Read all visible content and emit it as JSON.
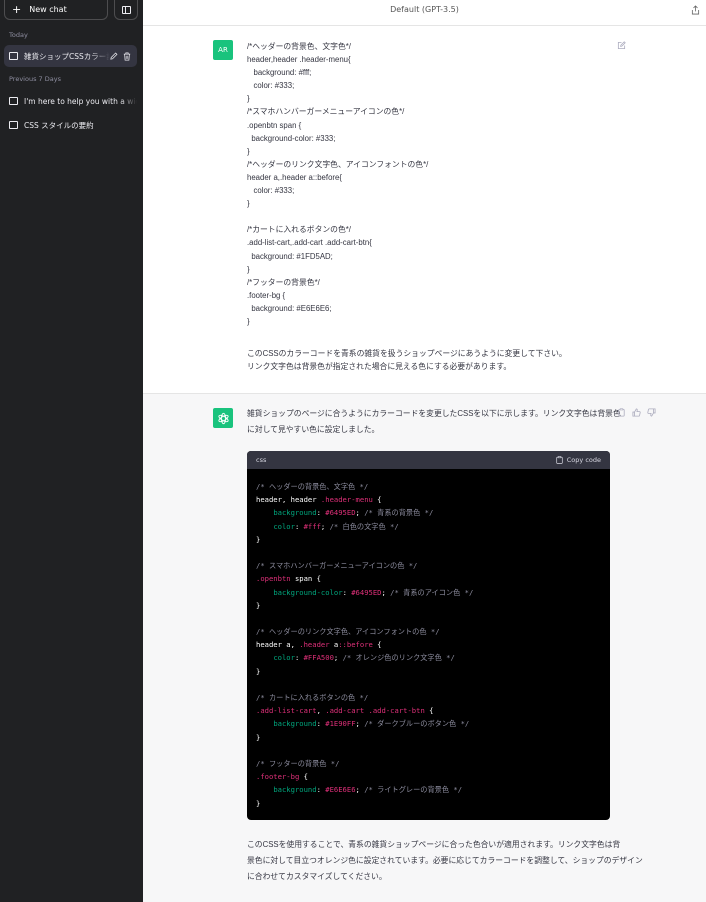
{
  "sidebar": {
    "new_chat_label": "New chat",
    "sections": [
      {
        "label": "Today",
        "items": [
          {
            "label": "雑貨ショップCSSカラー設定",
            "active": true
          }
        ]
      },
      {
        "label": "Previous 7 Days",
        "items": [
          {
            "label": "I'm here to help you with a wide range",
            "active": false
          },
          {
            "label": "CSS スタイルの要約",
            "active": false
          }
        ]
      }
    ]
  },
  "header": {
    "model": "Default (GPT-3.5)"
  },
  "user_message": {
    "avatar": "AR",
    "code_lines": [
      "/*ヘッダーの背景色、文字色*/",
      "header,header .header-menu{",
      "   background: #fff;",
      "   color: #333;",
      "}",
      "/*スマホハンバーガーメニューアイコンの色*/",
      ".openbtn span {",
      "  background-color: #333;",
      "}",
      "/*ヘッダーのリンク文字色、アイコンフォントの色*/",
      "header a,.header a::before{",
      "   color: #333;",
      "}",
      "",
      "/*カートに入れるボタンの色*/",
      ".add-list-cart,.add-cart .add-cart-btn{",
      "  background: #1FD5AD;",
      "}",
      "/*フッターの背景色*/",
      ".footer-bg {",
      "  background: #E6E6E6;",
      "}"
    ],
    "request_lines": [
      "このCSSのカラーコードを青系の雑貨を扱うショップページにあうように変更して下さい。",
      "リンク文字色は背景色が指定された場合に見える色にする必要があります。"
    ]
  },
  "assistant_message": {
    "intro": "雑貨ショップのページに合うようにカラーコードを変更したCSSを以下に示します。リンク文字色は背景色に対して見やすい色に設定しました。",
    "code_lang": "css",
    "copy_label": "Copy code",
    "code_lines": [
      [
        {
          "t": "/* ヘッダーの背景色、文字色 */",
          "c": "comment"
        }
      ],
      [
        {
          "t": "header, header ",
          "c": "sel"
        },
        {
          "t": ".header-menu",
          "c": "cls"
        },
        {
          "t": " {",
          "c": "punc"
        }
      ],
      [
        {
          "t": "    ",
          "c": "punc"
        },
        {
          "t": "background",
          "c": "prop"
        },
        {
          "t": ": ",
          "c": "punc"
        },
        {
          "t": "#6495ED",
          "c": "val"
        },
        {
          "t": "; ",
          "c": "punc"
        },
        {
          "t": "/* 青系の背景色 */",
          "c": "comment"
        }
      ],
      [
        {
          "t": "    ",
          "c": "punc"
        },
        {
          "t": "color",
          "c": "prop"
        },
        {
          "t": ": ",
          "c": "punc"
        },
        {
          "t": "#fff",
          "c": "val"
        },
        {
          "t": "; ",
          "c": "punc"
        },
        {
          "t": "/* 白色の文字色 */",
          "c": "comment"
        }
      ],
      [
        {
          "t": "}",
          "c": "punc"
        }
      ],
      [],
      [
        {
          "t": "/* スマホハンバーガーメニューアイコンの色 */",
          "c": "comment"
        }
      ],
      [
        {
          "t": ".openbtn",
          "c": "cls"
        },
        {
          "t": " span {",
          "c": "sel"
        }
      ],
      [
        {
          "t": "    ",
          "c": "punc"
        },
        {
          "t": "background-color",
          "c": "prop"
        },
        {
          "t": ": ",
          "c": "punc"
        },
        {
          "t": "#6495ED",
          "c": "val"
        },
        {
          "t": "; ",
          "c": "punc"
        },
        {
          "t": "/* 青系のアイコン色 */",
          "c": "comment"
        }
      ],
      [
        {
          "t": "}",
          "c": "punc"
        }
      ],
      [],
      [
        {
          "t": "/* ヘッダーのリンク文字色、アイコンフォントの色 */",
          "c": "comment"
        }
      ],
      [
        {
          "t": "header a, ",
          "c": "sel"
        },
        {
          "t": ".header",
          "c": "cls"
        },
        {
          "t": " a",
          "c": "sel"
        },
        {
          "t": "::before",
          "c": "cls"
        },
        {
          "t": " {",
          "c": "punc"
        }
      ],
      [
        {
          "t": "    ",
          "c": "punc"
        },
        {
          "t": "color",
          "c": "prop"
        },
        {
          "t": ": ",
          "c": "punc"
        },
        {
          "t": "#FFA500",
          "c": "val"
        },
        {
          "t": "; ",
          "c": "punc"
        },
        {
          "t": "/* オレンジ色のリンク文字色 */",
          "c": "comment"
        }
      ],
      [
        {
          "t": "}",
          "c": "punc"
        }
      ],
      [],
      [
        {
          "t": "/* カートに入れるボタンの色 */",
          "c": "comment"
        }
      ],
      [
        {
          "t": ".add-list-cart",
          "c": "cls"
        },
        {
          "t": ", ",
          "c": "punc"
        },
        {
          "t": ".add-cart .add-cart-btn",
          "c": "cls"
        },
        {
          "t": " {",
          "c": "punc"
        }
      ],
      [
        {
          "t": "    ",
          "c": "punc"
        },
        {
          "t": "background",
          "c": "prop"
        },
        {
          "t": ": ",
          "c": "punc"
        },
        {
          "t": "#1E90FF",
          "c": "val"
        },
        {
          "t": "; ",
          "c": "punc"
        },
        {
          "t": "/* ダークブルーのボタン色 */",
          "c": "comment"
        }
      ],
      [
        {
          "t": "}",
          "c": "punc"
        }
      ],
      [],
      [
        {
          "t": "/* フッターの背景色 */",
          "c": "comment"
        }
      ],
      [
        {
          "t": ".footer-bg",
          "c": "cls"
        },
        {
          "t": " {",
          "c": "punc"
        }
      ],
      [
        {
          "t": "    ",
          "c": "punc"
        },
        {
          "t": "background",
          "c": "prop"
        },
        {
          "t": ": ",
          "c": "punc"
        },
        {
          "t": "#E6E6E6",
          "c": "val"
        },
        {
          "t": "; ",
          "c": "punc"
        },
        {
          "t": "/* ライトグレーの背景色 */",
          "c": "comment"
        }
      ],
      [
        {
          "t": "}",
          "c": "punc"
        }
      ]
    ],
    "outro_lines": [
      "このCSSを使用することで、青系の雑貨ショップページに合った色合いが適用されます。リンク文字色は背",
      "景色に対して目立つオレンジ色に設定されています。必要に応じてカラーコードを調整して、ショップのデザイン",
      "に合わせてカスタマイズしてください。"
    ]
  },
  "colors": {
    "sidebar_bg": "#202123",
    "accent": "#19c37d",
    "code_bg": "#000000"
  }
}
